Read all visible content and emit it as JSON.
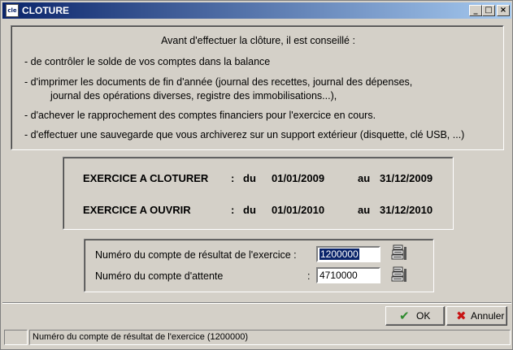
{
  "window": {
    "title": "CLOTURE",
    "app_icon_text": "cle"
  },
  "advice": {
    "title": "Avant d'effectuer la clôture, il est conseillé :",
    "lines": [
      "- de contrôler le solde de vos comptes dans la balance",
      "- d'imprimer les documents de fin d'année (journal des recettes, journal des dépenses,",
      "journal des opérations diverses, registre des immobilisations...),",
      "- d'achever le rapprochement  des comptes financiers pour l'exercice en cours.",
      "- d'effectuer une sauvegarde que vous archiverez sur un support extérieur (disquette, clé USB, ...)"
    ]
  },
  "periods": [
    {
      "label": "EXERCICE A CLOTURER",
      "colon": ":",
      "du": "du",
      "start": "01/01/2009",
      "au": "au",
      "end": "31/12/2009"
    },
    {
      "label": "EXERCICE A OUVRIR",
      "colon": ":",
      "du": "du",
      "start": "01/01/2010",
      "au": "au",
      "end": "31/12/2010"
    }
  ],
  "accounts": {
    "result_label": "Numéro du compte de résultat de l'exercice :",
    "result_value": "1200000",
    "waiting_label": "Numéro du compte d'attente",
    "waiting_colon": ":",
    "waiting_value": "4710000"
  },
  "buttons": {
    "ok": "OK",
    "cancel": "Annuler"
  },
  "status": {
    "text": "Numéro du compte de résultat de l'exercice (1200000)"
  },
  "colors": {
    "titlebar_start": "#0a246a",
    "titlebar_end": "#a6caf0",
    "face": "#d4d0c8",
    "ok_icon": "#2e8b2e",
    "cancel_icon": "#c81414"
  }
}
